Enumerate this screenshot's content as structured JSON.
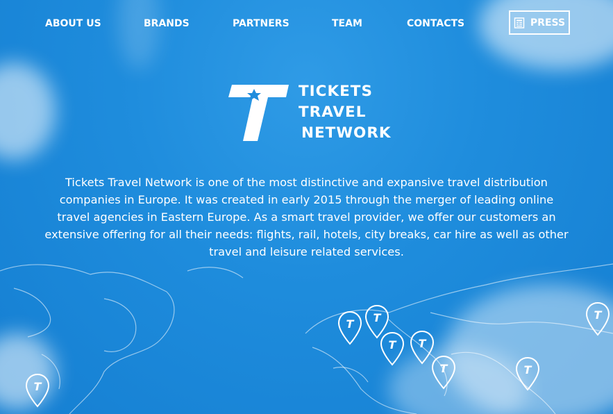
{
  "nav": {
    "items": [
      {
        "label": "ABOUT US"
      },
      {
        "label": "BRANDS"
      },
      {
        "label": "PARTNERS"
      },
      {
        "label": "TEAM"
      },
      {
        "label": "CONTACTS"
      }
    ],
    "press": {
      "label": "PRESS",
      "icon": "newspaper-icon"
    }
  },
  "logo": {
    "mark_letter": "T",
    "lines": [
      "TICKETS",
      "TRAVEL",
      "NETWORK"
    ]
  },
  "intro": {
    "text": "Tickets Travel Network is one of the most distinctive and expansive travel distribution companies in Europe. It was created in early 2015 through the merger of leading online travel agencies in Eastern Europe. As a smart travel provider, we offer our customers an extensive offering for all their needs: flights, rail, hotels, city breaks, car hire as well as other travel and leisure related services."
  },
  "map": {
    "pin_label": "T",
    "pin_icon": "map-pin-icon"
  },
  "colors": {
    "sky": "#1f8ddd",
    "text": "#ffffff"
  }
}
